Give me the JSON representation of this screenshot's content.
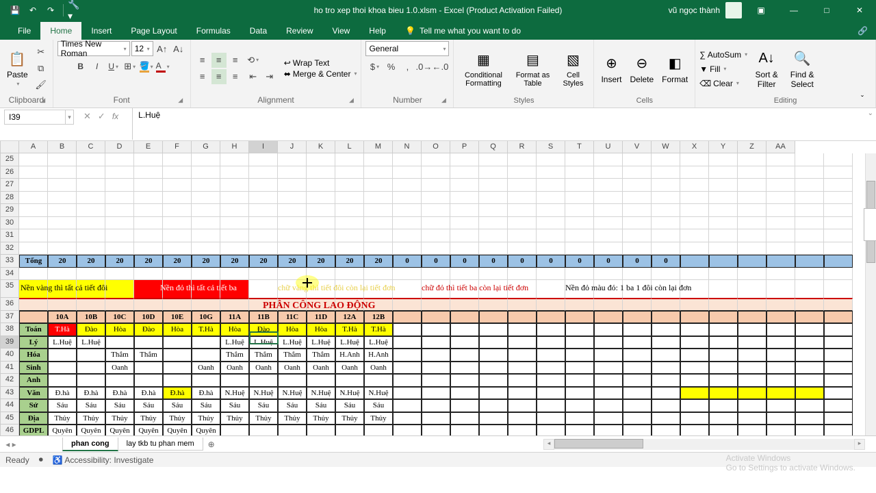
{
  "title": "ho tro xep thoi khoa bieu 1.0.xlsm - Excel (Product Activation Failed)",
  "user": "vũ ngọc thành",
  "tabs": [
    "File",
    "Home",
    "Insert",
    "Page Layout",
    "Formulas",
    "Data",
    "Review",
    "View",
    "Help"
  ],
  "tellme": "Tell me what you want to do",
  "ribbon": {
    "clipboard": "Clipboard",
    "paste": "Paste",
    "font": "Font",
    "fontname": "Times New Roman",
    "fontsize": "12",
    "alignment": "Alignment",
    "wrap": "Wrap Text",
    "merge": "Merge & Center",
    "number": "Number",
    "numfmt": "General",
    "styles": "Styles",
    "cf": "Conditional Formatting",
    "fat": "Format as Table",
    "cs": "Cell Styles",
    "cells": "Cells",
    "ins": "Insert",
    "del": "Delete",
    "fmt": "Format",
    "editing": "Editing",
    "sum": "AutoSum",
    "fill": "Fill",
    "clear": "Clear",
    "sort": "Sort & Filter",
    "find": "Find & Select"
  },
  "namebox": "I39",
  "formula": "L.Huệ",
  "cols": [
    "A",
    "B",
    "C",
    "D",
    "E",
    "F",
    "G",
    "H",
    "I",
    "J",
    "K",
    "L",
    "M",
    "N",
    "O",
    "P",
    "Q",
    "R",
    "S",
    "T",
    "U",
    "V",
    "W",
    "X",
    "Y",
    "Z",
    "AA"
  ],
  "rownums": [
    25,
    26,
    27,
    28,
    29,
    30,
    31,
    32,
    33,
    34,
    35,
    36,
    37,
    38,
    39,
    40,
    41,
    42,
    43,
    44,
    45,
    46
  ],
  "r33": [
    "Tổng",
    "20",
    "20",
    "20",
    "20",
    "20",
    "20",
    "20",
    "20",
    "20",
    "20",
    "20",
    "20",
    "0",
    "0",
    "0",
    "0",
    "0",
    "0",
    "0",
    "0",
    "0",
    "0"
  ],
  "note_yellow": "Nền vàng thì tất cả tiết đôi",
  "note_red": "Nền đỏ thì tất cả tiết ba",
  "note_yt": "chữ vàng thì tiết đôi còn lại tiết đơn",
  "note_rt": "chữ đỏ thì tiết ba còn lại tiết đơn",
  "note_rb": "Nền đỏ màu đỏ: 1 ba 1 đôi còn lại đơn",
  "r36": "PHÂN CÔNG LAO ĐỘNG",
  "r37": [
    "",
    "10A",
    "10B",
    "10C",
    "10D",
    "10E",
    "10G",
    "11A",
    "11B",
    "11C",
    "11D",
    "12A",
    "12B"
  ],
  "r38": [
    "Toán",
    "T.Hà",
    "Đào",
    "Hòa",
    "Đào",
    "Hòa",
    "T.Hà",
    "Hòa",
    "Đào",
    "Hòa",
    "Hòa",
    "T.Hà",
    "T.Hà"
  ],
  "r39": [
    "Lý",
    "L.Huệ",
    "L.Huệ",
    "",
    "",
    "",
    "",
    "L.Huệ",
    "L.Huệ",
    "L.Huệ",
    "L.Huệ",
    "L.Huệ",
    "L.Huệ"
  ],
  "r40": [
    "Hóa",
    "",
    "",
    "Thắm",
    "Thắm",
    "",
    "",
    "Thắm",
    "Thắm",
    "Thắm",
    "Thắm",
    "H.Anh",
    "H.Anh"
  ],
  "r41": [
    "Sinh",
    "",
    "",
    "Oanh",
    "",
    "",
    "Oanh",
    "Oanh",
    "Oanh",
    "Oanh",
    "Oanh",
    "Oanh",
    "Oanh"
  ],
  "r42": [
    "Anh",
    "",
    "",
    "",
    "",
    "",
    "",
    "",
    "",
    "",
    "",
    "",
    ""
  ],
  "r43": [
    "Văn",
    "Đ.hà",
    "Đ.hà",
    "Đ.hà",
    "Đ.hà",
    "Đ.hà",
    "Đ.hà",
    "N.Huệ",
    "N.Huệ",
    "N.Huệ",
    "N.Huệ",
    "N.Huệ",
    "N.Huệ"
  ],
  "r44": [
    "Sử",
    "Sáu",
    "Sáu",
    "Sáu",
    "Sáu",
    "Sáu",
    "Sáu",
    "Sáu",
    "Sáu",
    "Sáu",
    "Sáu",
    "Sáu",
    "Sáu"
  ],
  "r45": [
    "Địa",
    "Thủy",
    "Thủy",
    "Thủy",
    "Thủy",
    "Thủy",
    "Thủy",
    "Thủy",
    "Thủy",
    "Thủy",
    "Thủy",
    "Thủy",
    "Thủy"
  ],
  "r46": [
    "GDPL",
    "Quyên",
    "Quyên",
    "Quyên",
    "Quyên",
    "Quyên",
    "Quyên",
    "",
    "",
    "",
    "",
    "",
    ""
  ],
  "sheets": [
    "phan cong",
    "lay tkb tu phan mem"
  ],
  "status": {
    "ready": "Ready",
    "acc": "Accessibility: Investigate"
  },
  "watermark": {
    "t": "Activate Windows",
    "s": "Go to Settings to activate Windows."
  }
}
